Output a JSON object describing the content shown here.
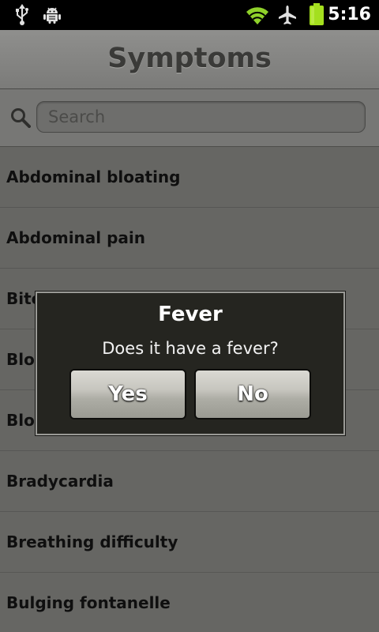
{
  "status_bar": {
    "time": "5:16",
    "icons": [
      "usb-icon",
      "android-debug-icon",
      "wifi-icon",
      "airplane-mode-icon",
      "battery-icon"
    ],
    "colors": {
      "wifi": "#8fd12a",
      "battery": "#a4df1e"
    }
  },
  "header": {
    "title": "Symptoms"
  },
  "search": {
    "placeholder": "Search",
    "value": ""
  },
  "symptoms": [
    "Abdominal bloating",
    "Abdominal pain",
    "Bite",
    "Bloo",
    "Bloo",
    "Bradycardia",
    "Breathing difficulty",
    "Bulging fontanelle"
  ],
  "dialog": {
    "title": "Fever",
    "message": "Does it have a fever?",
    "yes_label": "Yes",
    "no_label": "No"
  }
}
